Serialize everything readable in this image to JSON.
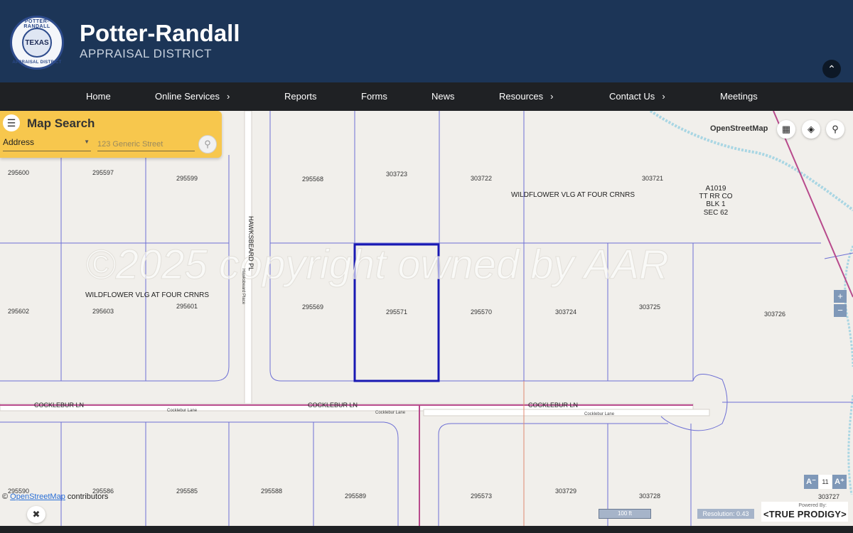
{
  "header": {
    "title": "Potter-Randall",
    "subtitle": "APPRAISAL DISTRICT",
    "seal": {
      "ring_top": "POTTER-RANDALL",
      "center": "TEXAS",
      "ring_bottom": "APPRAISAL DISTRICT"
    },
    "collapse_icon": "chevron-up-icon"
  },
  "nav": {
    "items": [
      {
        "label": "Home",
        "has_submenu": false
      },
      {
        "label": "Online Services",
        "has_submenu": true
      },
      {
        "label": "Reports",
        "has_submenu": false
      },
      {
        "label": "Forms",
        "has_submenu": false
      },
      {
        "label": "News",
        "has_submenu": false
      },
      {
        "label": "Resources",
        "has_submenu": true
      },
      {
        "label": "Contact Us",
        "has_submenu": true
      },
      {
        "label": "Meetings",
        "has_submenu": false
      }
    ]
  },
  "search": {
    "title": "Map Search",
    "type_selected": "Address",
    "placeholder": "123 Generic Street"
  },
  "map": {
    "basemap_label": "OpenStreetMap",
    "watermark": "©2025 copyright owned by AAR",
    "attribution_link": "OpenStreetMap",
    "attribution_suffix": " contributors",
    "attribution_prefix": "© ",
    "scale_label": "100 ft",
    "resolution_label": "Resolution: 0.43",
    "font_size": "11",
    "powered_by": "Powered By:",
    "powered_brand": "<TRUE PRODIGY>",
    "selected_parcel": "295571",
    "parcels": [
      "295600",
      "295597",
      "295599",
      "295568",
      "303723",
      "303722",
      "303721",
      "295602",
      "295603",
      "295601",
      "295569",
      "295571",
      "295570",
      "303724",
      "303725",
      "303726",
      "295590",
      "295586",
      "295585",
      "295588",
      "295589",
      "295573",
      "303729",
      "303728",
      "303727"
    ],
    "subdivision_labels": [
      "WILDFLOWER VLG AT FOUR CRNRS",
      "WILDFLOWER VLG AT FOUR CRNRS"
    ],
    "survey_label": [
      "A1019",
      "TT RR CO",
      "BLK 1",
      "SEC 62"
    ],
    "street_labels": [
      "COCKLEBUR LN",
      "COCKLEBUR LN",
      "COCKLEBUR LN",
      "Cocklebur Lane",
      "Cocklebur Lane",
      "Cocklebur Lane",
      "HAWKSBEARD PL",
      "Hawksbeard Place"
    ],
    "colors": {
      "parcel_line": "#6d6fd4",
      "selected": "#1919b3",
      "road_line": "#b84a8c",
      "water": "#a9d6e3",
      "header": "#1c3557",
      "panel": "#f7c74d"
    }
  }
}
